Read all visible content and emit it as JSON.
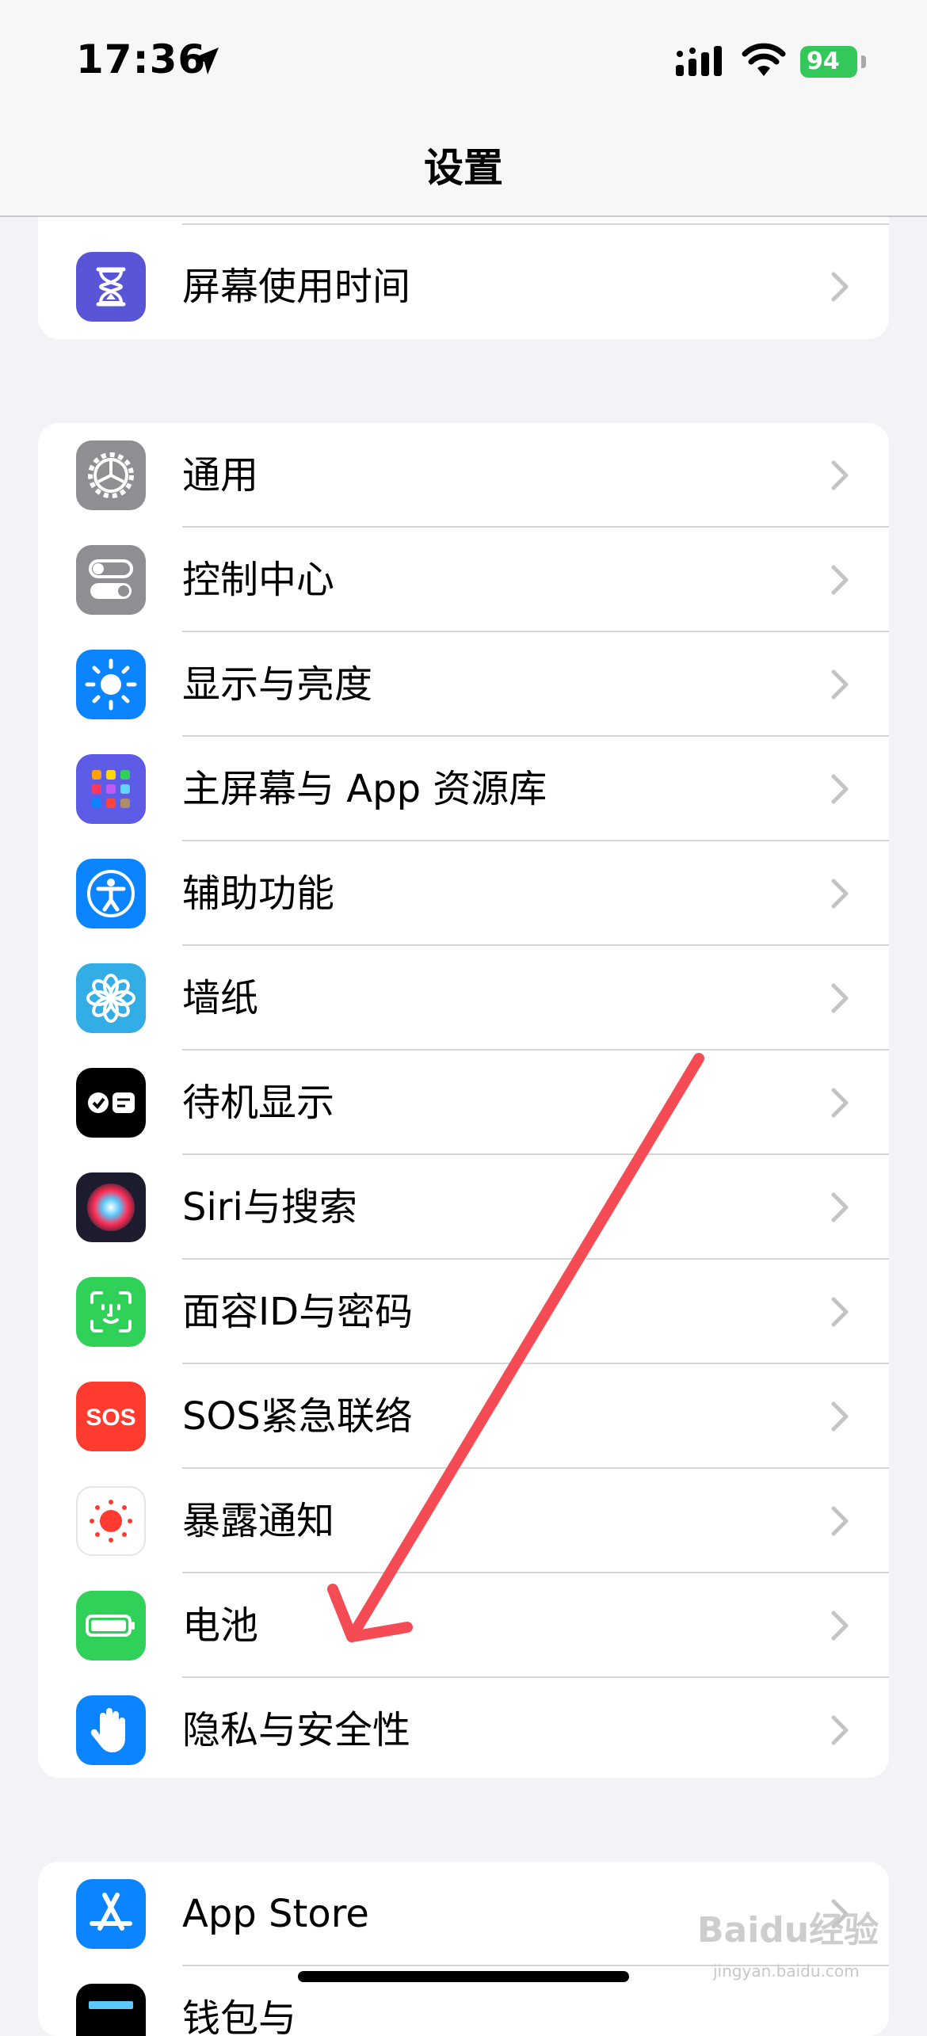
{
  "status_bar": {
    "time": "17:36",
    "battery": "94"
  },
  "nav": {
    "title": "设置"
  },
  "groups": [
    {
      "items": [
        {
          "label": "屏幕使用时间",
          "icon": "hourglass-icon"
        }
      ]
    },
    {
      "items": [
        {
          "label": "通用",
          "icon": "gear-icon"
        },
        {
          "label": "控制中心",
          "icon": "toggles-icon"
        },
        {
          "label": "显示与亮度",
          "icon": "sun-icon"
        },
        {
          "label": "主屏幕与 App 资源库",
          "icon": "app-grid-icon"
        },
        {
          "label": "辅助功能",
          "icon": "accessibility-icon"
        },
        {
          "label": "墙纸",
          "icon": "flower-icon"
        },
        {
          "label": "待机显示",
          "icon": "standby-icon"
        },
        {
          "label": "Siri与搜索",
          "icon": "siri-icon"
        },
        {
          "label": "面容ID与密码",
          "icon": "face-id-icon"
        },
        {
          "label": "SOS紧急联络",
          "icon": "sos-icon"
        },
        {
          "label": "暴露通知",
          "icon": "exposure-icon"
        },
        {
          "label": "电池",
          "icon": "battery-icon"
        },
        {
          "label": "隐私与安全性",
          "icon": "hand-icon"
        }
      ]
    },
    {
      "items": [
        {
          "label": "App Store",
          "icon": "app-store-icon"
        },
        {
          "label": "钱包与",
          "icon": "wallet-icon"
        }
      ]
    }
  ],
  "watermark": {
    "brand": "Baidu经验",
    "sub": "jingyan.baidu.com"
  }
}
